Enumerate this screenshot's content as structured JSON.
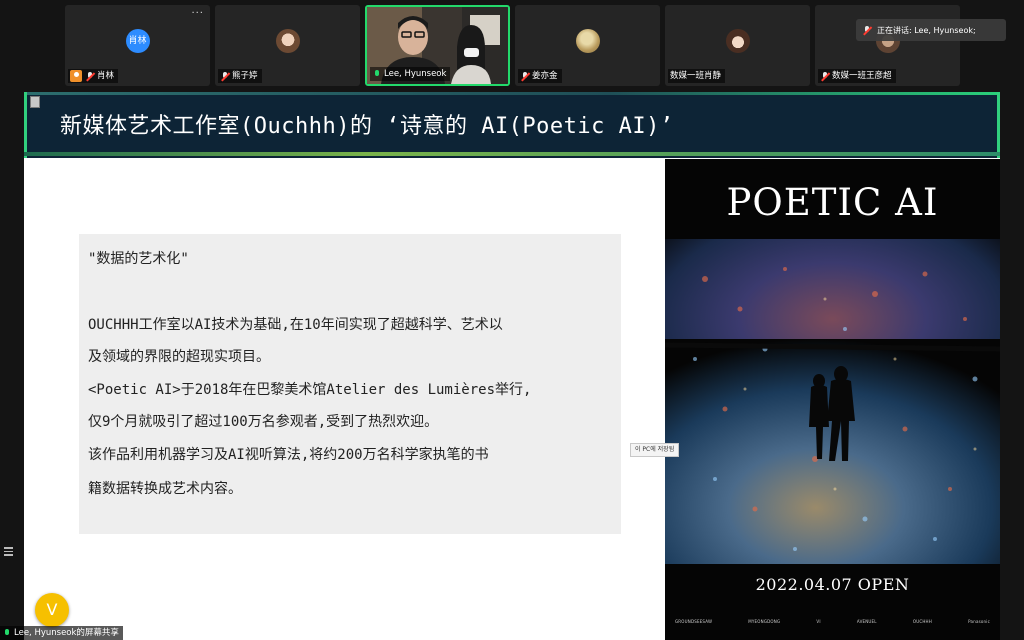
{
  "participants": [
    {
      "name": "肖林",
      "initials": "肖林",
      "avatar_color": "#2d8cff",
      "muted": true,
      "host": true
    },
    {
      "name": "熊子婷",
      "muted": true
    },
    {
      "name": "Lee, Hyunseok",
      "muted": false,
      "active_speaker": true
    },
    {
      "name": "姜亦金",
      "muted": true
    },
    {
      "name": "数媒一班肖静",
      "muted": false
    },
    {
      "name": "数媒一班王彦超",
      "muted": true
    }
  ],
  "speaking_label": "正在讲话: Lee, Hyunseok;",
  "tile_menu": "···",
  "slide": {
    "title": "新媒体艺术工作室(Ouchhh)的 ‘诗意的 AI(Poetic AI)’",
    "quote": "\"数据的艺术化\"",
    "paragraph_lines": [
      "OUCHHH工作室以AI技术为基础,在10年间实现了超越科学、艺术以",
      "及领域的界限的超现实项目。",
      "<Poetic AI>于2018年在巴黎美术馆Atelier des Lumières举行,",
      "仅9个月就吸引了超过100万名参观者,受到了热烈欢迎。",
      "该作品利用机器学习及AI视听算法,将约200万名科学家执笔的书",
      "籍数据转换成艺术内容。"
    ],
    "poster": {
      "title": "POETIC AI",
      "date": "2022.04.07 OPEN",
      "credits": [
        "GROUNDSEESAW",
        "MYEONGDONG",
        "VI",
        "AVENUEL",
        "OUCHHH",
        "Panasonic"
      ]
    },
    "tooltip": "이 PC에 저장됨"
  },
  "share_label": "Lee, Hyunseok的屏幕共享",
  "annotate_button": "V",
  "colors": {
    "accent_green": "#23d96b",
    "title_bar": "#0d2436",
    "annotate": "#f6c000"
  }
}
